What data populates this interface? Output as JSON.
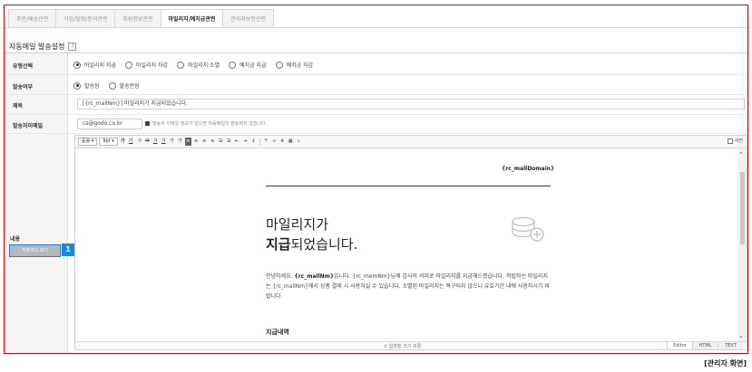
{
  "tabs": [
    {
      "label": "주문/배송관련",
      "active": false
    },
    {
      "label": "가입/탈퇴/문의관련",
      "active": false
    },
    {
      "label": "회원정보관련",
      "active": false
    },
    {
      "label": "마일리지/예치금관련",
      "active": true
    },
    {
      "label": "관리자보안관련",
      "active": false
    }
  ],
  "section": {
    "title": "자동메일 발송설정",
    "help": "?"
  },
  "form": {
    "type_label": "유형선택",
    "type_options": [
      "마일리지 지급",
      "마일리지 차감",
      "마일리지 소멸",
      "예치금 지급",
      "예치금 차감"
    ],
    "type_selected": 0,
    "send_label": "발송여부",
    "send_options": [
      "발송함",
      "발송안함"
    ],
    "send_selected": 0,
    "subject_label": "제목",
    "subject_value": "[{rc_mallNm}] 마일리지가 지급되었습니다.",
    "sender_label": "발송자이메일",
    "sender_value": "cs@godo.co.kr",
    "sender_hint": "발송자 이메일 정보가 없으면 자동메일이 발송되지 않습니다.",
    "content_label": "내용",
    "source_button": "치환코드 보기",
    "badge": "1"
  },
  "editor": {
    "font_select": "돋움",
    "size_select": "9pt",
    "toolbar_buttons": [
      "가",
      "가",
      "가",
      "가",
      "가",
      "가",
      "가",
      "가"
    ],
    "right_label": "사진",
    "domain": "{rc_mallDomain}",
    "headline_line1": "마일리지가",
    "headline_bold": "지급",
    "headline_rest": "되었습니다.",
    "body_prefix": "안녕하세요. ",
    "body_bold": "{rc_mallNm}",
    "body_rest": "입니다. {rc_memNm}님께 감사의 의미로 마일리지를 지급해드렸습니다. 적립하신 마일리지는 {rc_mallNm}에서 상품 결제 시 사용하실 수 있습니다. 소멸된 마일리지는 복구되지 않으니 유효기간 내에 사용하시기 바랍니다.",
    "sub_title": "지급내역",
    "resize_label": "⇕ 입력창 크기 조절",
    "modes": [
      "Editor",
      "HTML",
      "TEXT"
    ],
    "mode_active": 0
  },
  "caption": "[관리자 화면]",
  "colors": {
    "frame": "#d9000d",
    "badge": "#1e88e5"
  }
}
